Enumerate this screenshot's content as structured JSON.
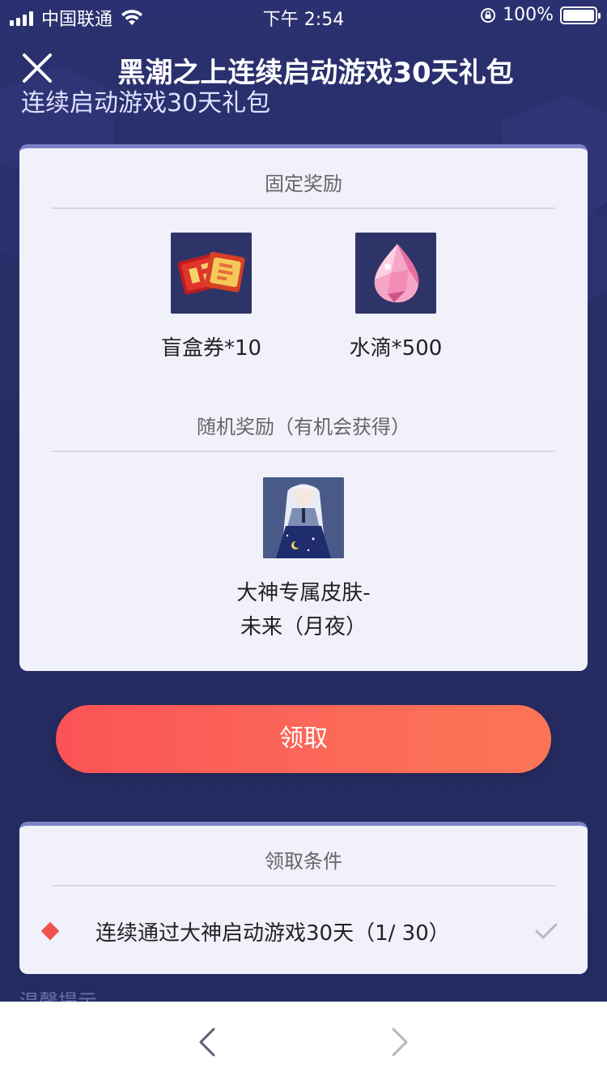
{
  "status_bar": {
    "carrier": "中国联通",
    "time": "下午 2:54",
    "battery": "100%"
  },
  "header": {
    "title": "黑潮之上连续启动游戏30天礼包",
    "subtitle": "连续启动游戏30天礼包"
  },
  "fixed_rewards": {
    "title": "固定奖励",
    "items": [
      {
        "label": "盲盒券*10",
        "icon": "ticket-bundle-icon"
      },
      {
        "label": "水滴*500",
        "icon": "pink-crystal-drop-icon"
      }
    ]
  },
  "random_rewards": {
    "title": "随机奖励（有机会获得）",
    "items": [
      {
        "label_line1": "大神专属皮肤-",
        "label_line2": "未来（月夜）",
        "icon": "anime-character-skin-icon"
      }
    ]
  },
  "claim_button": {
    "label": "领取"
  },
  "conditions": {
    "title": "领取条件",
    "items": [
      {
        "text": "连续通过大神启动游戏30天（1/ 30）",
        "done": true
      }
    ]
  },
  "tip_peek": "温馨提示",
  "colors": {
    "background": "#272d66",
    "card": "#f0f1fb",
    "button_start": "#fb5356",
    "button_end": "#fb7556",
    "diamond": "#ef5350"
  }
}
